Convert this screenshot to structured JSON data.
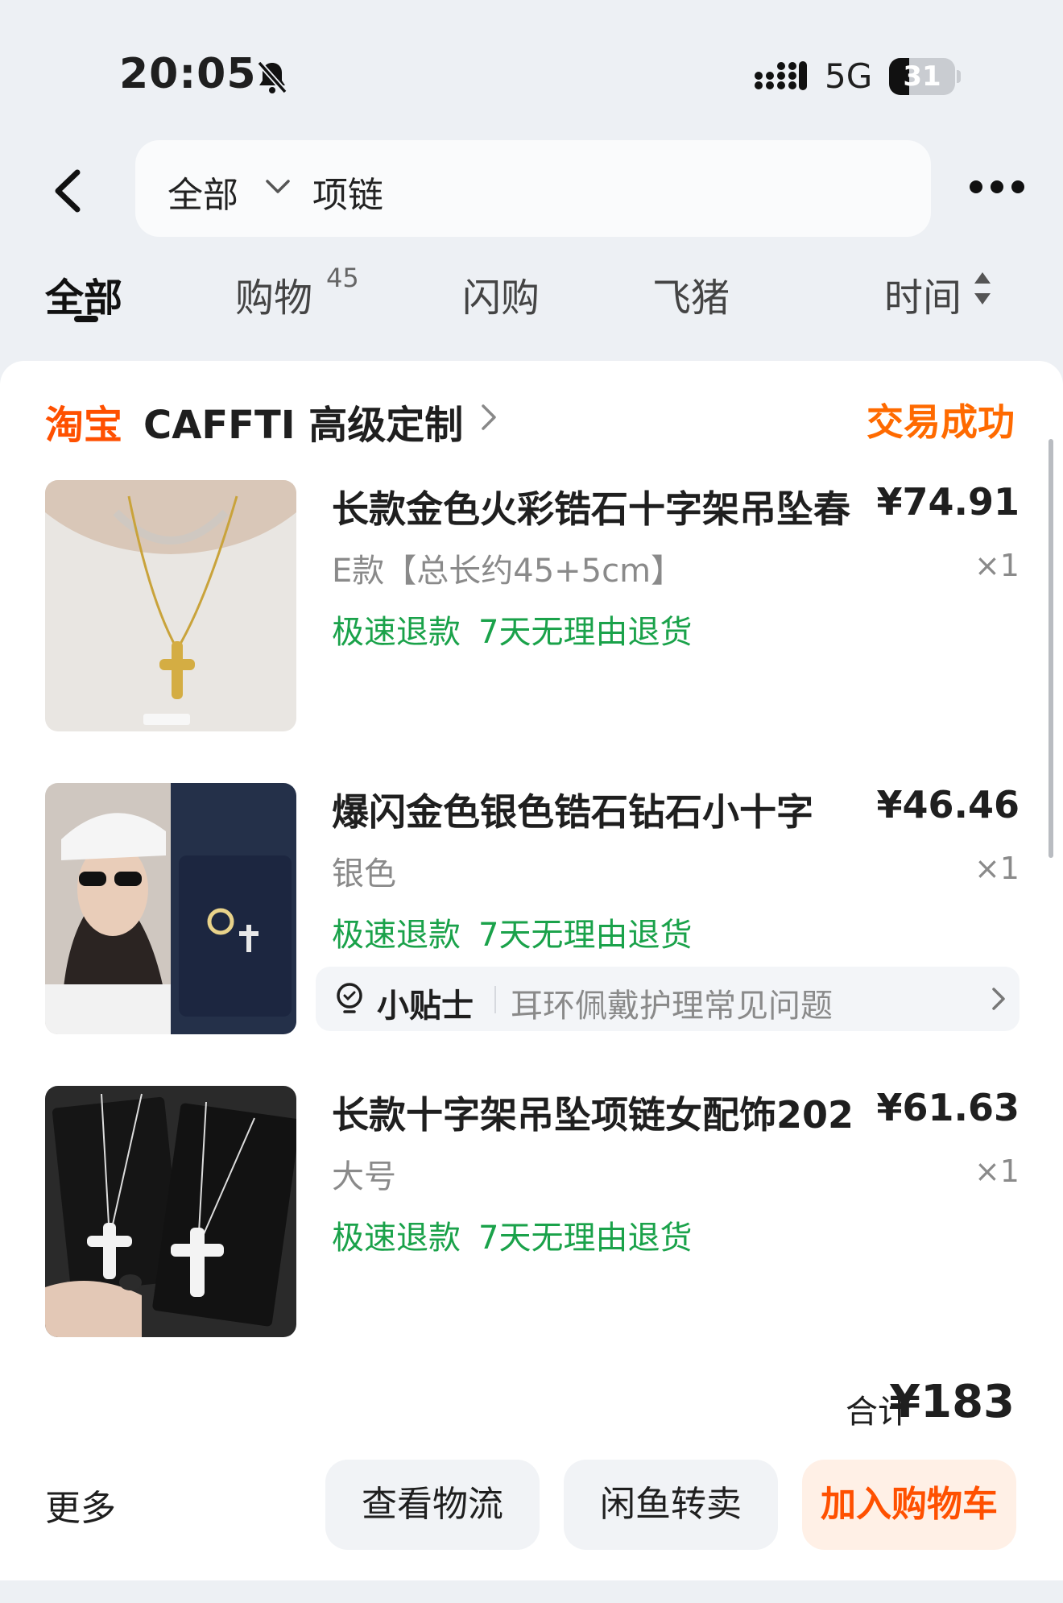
{
  "status_bar": {
    "time": "20:05",
    "network": "5G",
    "battery": "31",
    "battery_level": 0.31
  },
  "header": {
    "search_scope": "全部",
    "search_query": "项链"
  },
  "tabs": {
    "all": "全部",
    "shopping": "购物",
    "shopping_count": "45",
    "flash": "闪购",
    "fliggy": "飞猪",
    "time": "时间"
  },
  "shop": {
    "brand": "淘宝",
    "name": "CAFFTI 高级定制",
    "status": "交易成功"
  },
  "items": [
    {
      "title": "长款金色火彩锆石十字架吊坠春",
      "price": "¥74.91",
      "sku": "E款【总长约45+5cm】",
      "qty": "×1",
      "badge1": "极速退款",
      "badge2": "7天无理由退货"
    },
    {
      "title": "爆闪金色银色锆石钻石小十字",
      "price": "¥46.46",
      "sku": "银色",
      "qty": "×1",
      "badge1": "极速退款",
      "badge2": "7天无理由退货",
      "tip_label": "小贴士",
      "tip_text": "耳环佩戴护理常见问题"
    },
    {
      "title": "长款十字架吊坠项链女配饰202",
      "price": "¥61.63",
      "sku": "大号",
      "qty": "×1",
      "badge1": "极速退款",
      "badge2": "7天无理由退货"
    }
  ],
  "total": {
    "label": "合计",
    "value": "¥183"
  },
  "actions": {
    "more": "更多",
    "logistics": "查看物流",
    "resell": "闲鱼转卖",
    "add_cart": "加入购物车"
  },
  "colors": {
    "brand_orange": "#ff5000",
    "status_orange": "#ff6a00",
    "badge_green": "#1aa24a"
  }
}
